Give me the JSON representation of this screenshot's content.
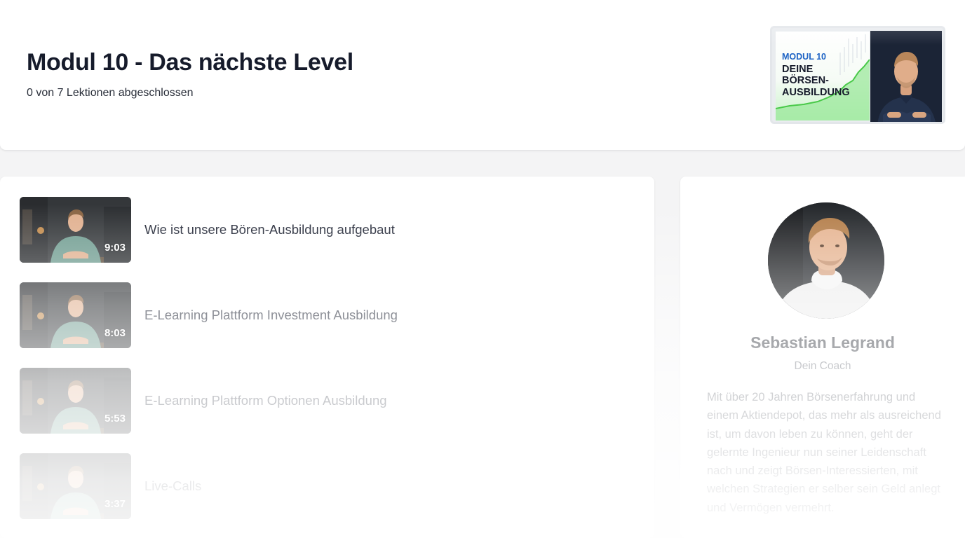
{
  "header": {
    "title": "Modul 10 - Das nächste Level",
    "progress": "0 von 7 Lektionen abgeschlossen",
    "thumbnail": {
      "label": "MODUL 10",
      "lines": [
        "DEINE",
        "BÖRSEN-",
        "AUSBILDUNG"
      ],
      "accent_color": "#1d63c5",
      "chart_color": "#7fe07f"
    }
  },
  "lessons": [
    {
      "title": "Wie ist unsere Bören-Ausbildung aufgebaut",
      "duration": "9:03"
    },
    {
      "title": "E-Learning Plattform Investment Ausbildung",
      "duration": "8:03"
    },
    {
      "title": "E-Learning Plattform Optionen Ausbildung",
      "duration": "5:53"
    },
    {
      "title": "Live-Calls",
      "duration": "3:37"
    }
  ],
  "coach": {
    "name": "Sebastian Legrand",
    "role": "Dein Coach",
    "bio": "Mit über 20 Jahren Börsenerfahrung und einem Aktiendepot, das mehr als ausreichend ist, um davon leben zu können, geht der gelernte Ingenieur nun seiner Leidenschaft nach und zeigt Börsen-Interessierten, mit welchen Strategien er selber sein Geld anlegt und Vermögen vermehrt."
  },
  "icons": {
    "video_thumbnail": "play-video-icon",
    "avatar": "coach-avatar-image"
  }
}
